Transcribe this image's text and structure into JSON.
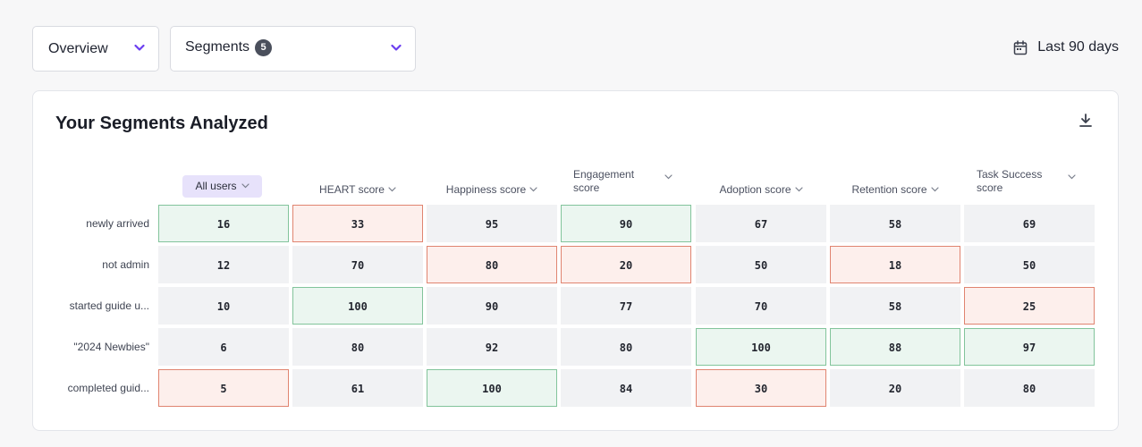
{
  "toolbar": {
    "overview_label": "Overview",
    "segments_label": "Segments",
    "segments_count": "5",
    "date_range": "Last 90 days"
  },
  "card": {
    "title": "Your Segments Analyzed"
  },
  "columns": [
    {
      "label": "All users",
      "selected": true
    },
    {
      "label": "HEART score"
    },
    {
      "label": "Happiness score"
    },
    {
      "label": "Engagement score"
    },
    {
      "label": "Adoption score"
    },
    {
      "label": "Retention score"
    },
    {
      "label": "Task Success score"
    }
  ],
  "rows": [
    {
      "label": "newly arrived",
      "values": [
        "16",
        "33",
        "95",
        "90",
        "67",
        "58",
        "69"
      ]
    },
    {
      "label": "not admin",
      "values": [
        "12",
        "70",
        "80",
        "20",
        "50",
        "18",
        "50"
      ]
    },
    {
      "label": "started guide u...",
      "values": [
        "10",
        "100",
        "90",
        "77",
        "70",
        "58",
        "25"
      ]
    },
    {
      "label": "\"2024 Newbies\"",
      "values": [
        "6",
        "80",
        "92",
        "80",
        "100",
        "88",
        "97"
      ]
    },
    {
      "label": "completed guid...",
      "values": [
        "5",
        "61",
        "100",
        "84",
        "30",
        "20",
        "80"
      ]
    }
  ],
  "highlights": [
    [
      "good",
      "bad",
      "",
      "good",
      "",
      "",
      ""
    ],
    [
      "",
      "",
      "bad",
      "bad",
      "",
      "bad",
      ""
    ],
    [
      "",
      "good",
      "",
      "",
      "",
      "",
      "bad"
    ],
    [
      "",
      "",
      "",
      "",
      "good",
      "good",
      "good"
    ],
    [
      "bad",
      "",
      "good",
      "",
      "bad",
      "",
      ""
    ]
  ],
  "colors": {
    "good_border": "#82c49b",
    "good_fill": "#ebf6f0",
    "bad_border": "#e08470",
    "bad_fill": "#fdefec",
    "accent": "#6a3df0"
  },
  "icons": {
    "chevron": "chevron-down-icon",
    "calendar": "calendar-icon",
    "download": "download-icon"
  }
}
